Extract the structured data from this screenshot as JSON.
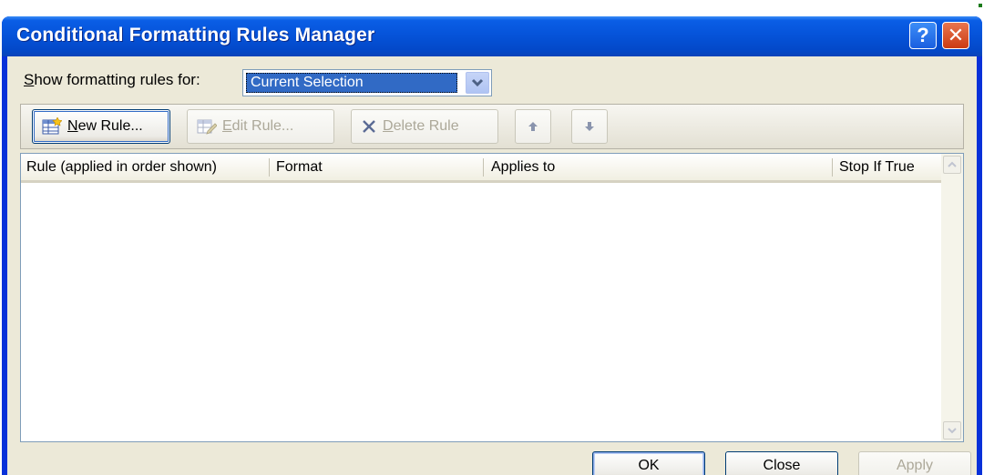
{
  "window": {
    "title": "Conditional Formatting Rules Manager",
    "help_glyph": "?",
    "close_glyph": "✕"
  },
  "filter": {
    "label_accel": "S",
    "label_rest": "how formatting rules for:",
    "selected": "Current Selection"
  },
  "toolbar": {
    "new_rule": {
      "accel": "N",
      "rest": "ew Rule...",
      "icon": "new-rule-icon",
      "enabled": true
    },
    "edit_rule": {
      "accel": "E",
      "rest": "dit Rule...",
      "icon": "edit-rule-icon",
      "enabled": false
    },
    "delete_rule": {
      "accel": "D",
      "rest": "elete Rule",
      "icon": "delete-x-icon",
      "enabled": false
    },
    "move_up": {
      "icon": "arrow-up-icon"
    },
    "move_down": {
      "icon": "arrow-down-icon"
    }
  },
  "table": {
    "columns": [
      "Rule (applied in order shown)",
      "Format",
      "Applies to",
      "Stop If True"
    ],
    "rows": []
  },
  "footer": {
    "ok": "OK",
    "close": "Close",
    "apply": "Apply"
  },
  "colors": {
    "title_bar": "#0552d8",
    "dialog_face": "#ece9d8",
    "selection": "#316ac5",
    "close_button": "#cc3b12"
  }
}
